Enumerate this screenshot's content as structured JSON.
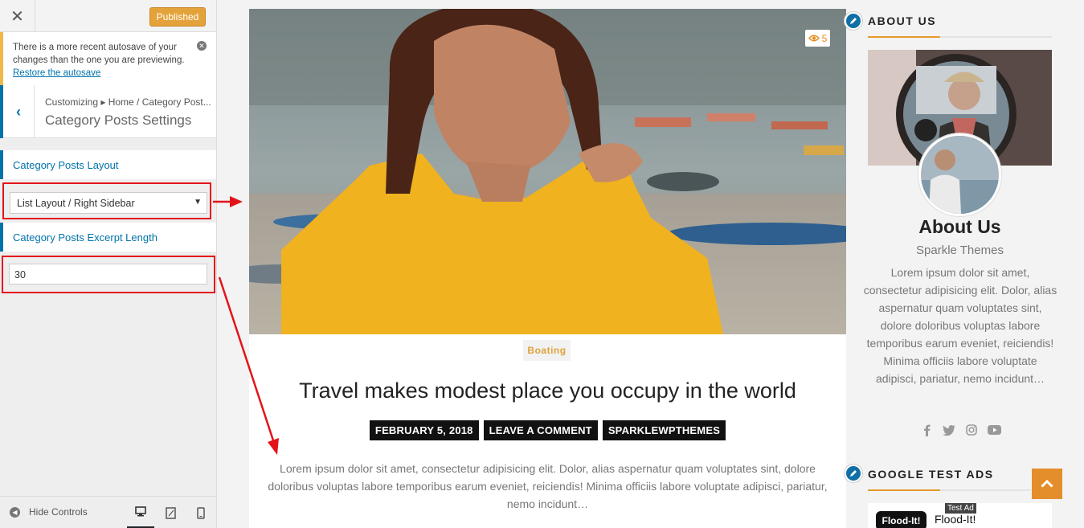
{
  "customizer": {
    "close_glyph": "✕",
    "publish_label": "Published",
    "notice": {
      "text": "There is a more recent autosave of your changes than the one you are previewing.",
      "link": "Restore the autosave",
      "dismiss_glyph": "✕"
    },
    "breadcrumb": "Customizing ▸ Home / Category Post...",
    "section_title": "Category Posts Settings",
    "back_glyph": "‹",
    "layout_control": {
      "label": "Category Posts Layout",
      "selected": "List Layout / Right Sidebar",
      "arrow": "▼"
    },
    "excerpt_control": {
      "label": "Category Posts Excerpt Length",
      "value": "30"
    },
    "footer": {
      "hide_label": "Hide Controls",
      "hide_glyph": "◀",
      "devices": [
        "desktop-icon",
        "tablet-icon",
        "mobile-icon"
      ],
      "active_device": "desktop"
    },
    "accent": "#0073aa",
    "publish_color": "#e4a33a",
    "highlight_color": "#e3131b"
  },
  "post": {
    "views": "5",
    "category": "Boating",
    "title": "Travel makes modest place you occupy in the world",
    "meta": [
      "FEBRUARY 5, 2018",
      "LEAVE A COMMENT",
      "SPARKLEWPTHEMES"
    ],
    "excerpt": "Lorem ipsum dolor sit amet, consectetur adipisicing elit. Dolor, alias aspernatur quam voluptates sint, dolore doloribus voluptas labore temporibus earum eveniet, reiciendis! Minima officiis labore voluptate adipisci, pariatur, nemo incidunt…"
  },
  "sidebar": {
    "about": {
      "widget_title": "ABOUT US",
      "name": "About Us",
      "subtitle": "Sparkle Themes",
      "text": "Lorem ipsum dolor sit amet, consectetur adipisicing elit. Dolor, alias aspernatur quam voluptates sint, dolore doloribus voluptas labore temporibus earum eveniet, reiciendis! Minima officiis labore voluptate adipisci, pariatur, nemo incidunt…",
      "socials": [
        "facebook-icon",
        "twitter-icon",
        "instagram-icon",
        "youtube-icon"
      ]
    },
    "ads": {
      "widget_title": "GOOGLE TEST ADS",
      "badge": "Test Ad",
      "logo": "Flood-It!",
      "name": "Flood-It!"
    },
    "accent": "#e49a2f"
  }
}
